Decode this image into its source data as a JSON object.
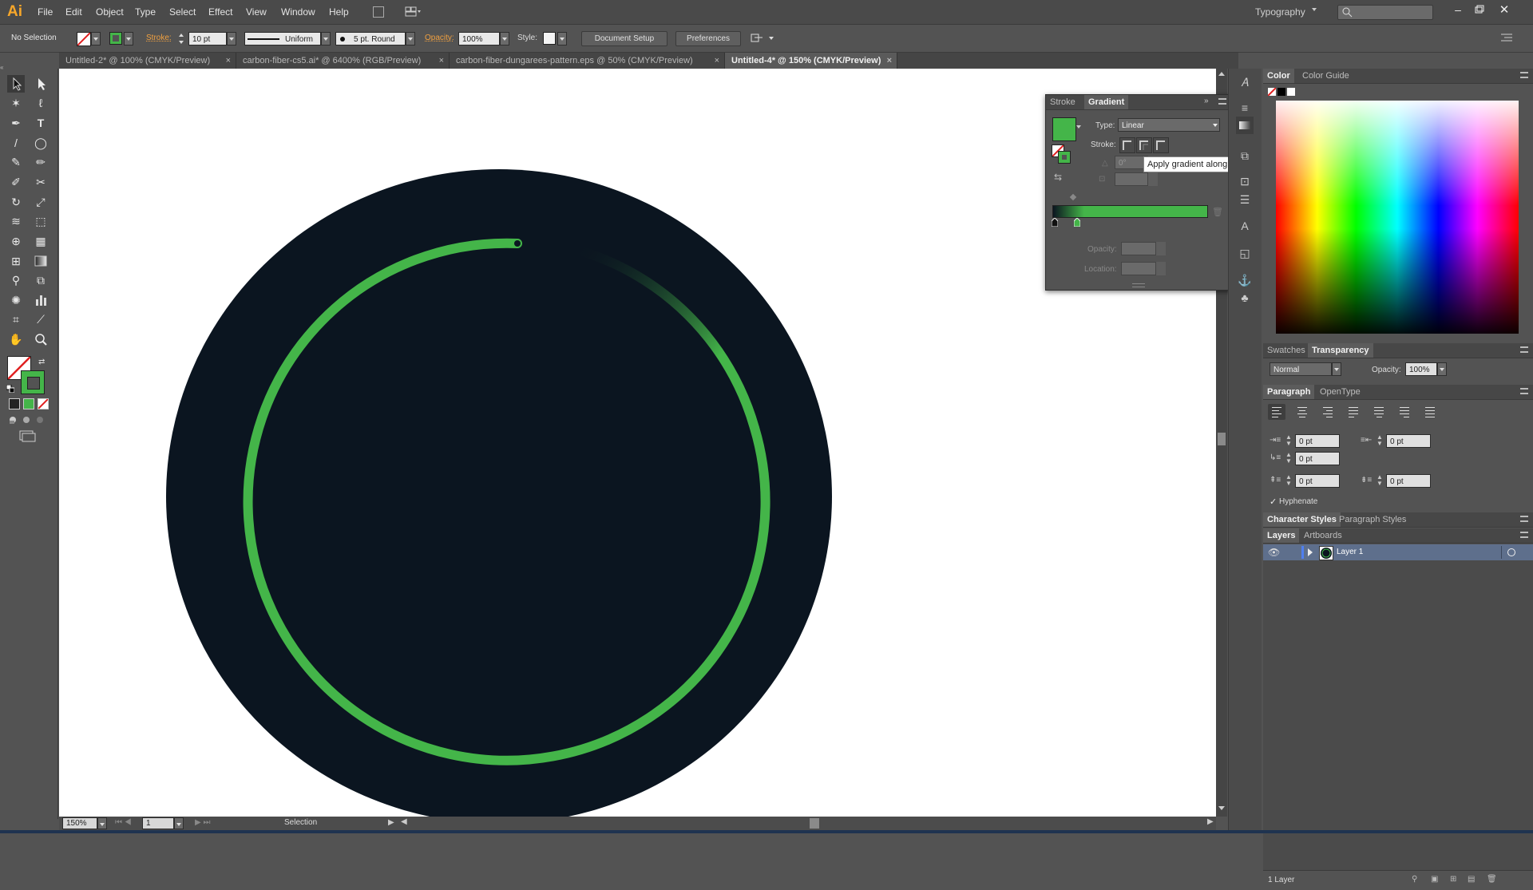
{
  "app": {
    "logo": "Ai",
    "workspace": "Typography"
  },
  "menus": [
    "File",
    "Edit",
    "Object",
    "Type",
    "Select",
    "Effect",
    "View",
    "Window",
    "Help"
  ],
  "control_bar": {
    "selection": "No Selection",
    "stroke_label": "Stroke:",
    "stroke_weight": "10 pt",
    "profile": "Uniform",
    "brush": "5 pt. Round",
    "opacity_label": "Opacity:",
    "opacity": "100%",
    "style_label": "Style:",
    "document_setup": "Document Setup",
    "preferences": "Preferences"
  },
  "tabs": [
    {
      "title": "Untitled-2* @ 100% (CMYK/Preview)",
      "active": false
    },
    {
      "title": "carbon-fiber-cs5.ai* @ 6400% (RGB/Preview)",
      "active": false
    },
    {
      "title": "carbon-fiber-dungarees-pattern.eps @ 50% (CMYK/Preview)",
      "active": false
    },
    {
      "title": "Untitled-4* @ 150% (CMYK/Preview)",
      "active": true
    }
  ],
  "status": {
    "zoom": "150%",
    "artboard": "1",
    "tool": "Selection",
    "layers_count": "1 Layer"
  },
  "gradient_panel": {
    "tab_stroke": "Stroke",
    "tab_gradient": "Gradient",
    "type_label": "Type:",
    "type_value": "Linear",
    "stroke_label": "Stroke:",
    "angle_value": "0°",
    "opacity_label": "Opacity:",
    "location_label": "Location:",
    "tooltip": "Apply gradient along stroke"
  },
  "color_panel": {
    "tab_color": "Color",
    "tab_guide": "Color Guide"
  },
  "transparency_panel": {
    "tab_swatches": "Swatches",
    "tab_transparency": "Transparency",
    "blend_mode": "Normal",
    "opacity_label": "Opacity:",
    "opacity": "100%"
  },
  "paragraph_panel": {
    "tab_paragraph": "Paragraph",
    "tab_opentype": "OpenType",
    "left_indent": "0 pt",
    "right_indent": "0 pt",
    "first_line": "0 pt",
    "space_before": "0 pt",
    "space_after": "0 pt",
    "hyphenate": "Hyphenate"
  },
  "styles_panel": {
    "tab_char": "Character Styles",
    "tab_para": "Paragraph Styles"
  },
  "layers_panel": {
    "tab_layers": "Layers",
    "tab_artboards": "Artboards",
    "layer_name": "Layer 1"
  },
  "colors": {
    "circle": "#0b1520",
    "ring": "#44b549",
    "accent_orange": "#f7a72a",
    "layer_highlight": "#5e6f8c"
  },
  "icons": [
    "selection-tool-icon",
    "direct-selection-tool-icon",
    "magic-wand-icon",
    "lasso-icon",
    "pen-tool-icon",
    "type-tool-icon",
    "line-tool-icon",
    "ellipse-tool-icon",
    "paintbrush-icon",
    "pencil-icon",
    "blob-brush-icon",
    "scissors-icon",
    "rotate-icon",
    "scale-icon",
    "warp-icon",
    "free-transform-icon",
    "shape-builder-icon",
    "perspective-grid-icon",
    "mesh-icon",
    "gradient-tool-icon",
    "eyedropper-icon",
    "blend-tool-icon",
    "symbol-sprayer-icon",
    "graph-tool-icon",
    "artboard-tool-icon",
    "slice-tool-icon",
    "hand-tool-icon",
    "zoom-tool-icon"
  ]
}
